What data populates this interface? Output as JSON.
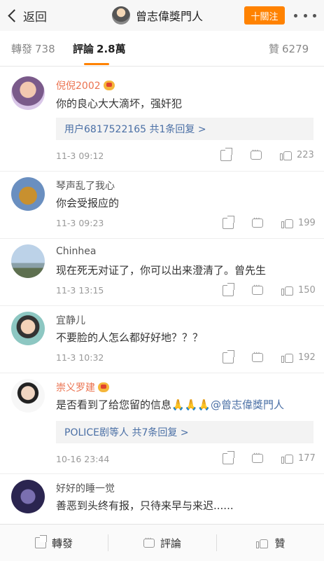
{
  "header": {
    "back_label": "返回",
    "title": "曾志偉獎門人",
    "follow_label": "十關注",
    "more_icon": "more-dots-icon"
  },
  "tabs": [
    {
      "label": "轉發",
      "count": "738"
    },
    {
      "label": "評論",
      "count": "2.8萬"
    },
    {
      "label": "贊",
      "count": "6279"
    }
  ],
  "comments": [
    {
      "user": "倪倪2002",
      "vip": true,
      "text": "你的良心大大滴坏，强奸犯",
      "reply": "用户6817522165  共1条回复 >",
      "time": "11-3 09:12",
      "likes": "223"
    },
    {
      "user": "琴声乱了我心",
      "vip": false,
      "text": "你会受报应的",
      "reply": null,
      "time": "11-3 09:23",
      "likes": "199"
    },
    {
      "user": "Chinhea",
      "vip": false,
      "text": "现在死无对证了，你可以出来澄清了。曾先生",
      "reply": null,
      "time": "11-3 13:15",
      "likes": "150"
    },
    {
      "user": "宜静儿",
      "vip": false,
      "text": "不要脸的人怎么都好好地？？？",
      "reply": null,
      "time": "11-3 10:32",
      "likes": "192"
    },
    {
      "user": "崇义罗建",
      "vip": true,
      "text": "是否看到了给您留的信息🙏🙏🙏",
      "mention": "@曾志偉獎門人",
      "reply": "POLICE剧等人  共7条回复 >",
      "time": "10-16 23:44",
      "likes": "177"
    },
    {
      "user": "好好的睡一觉",
      "vip": false,
      "text": "善恶到头终有报，只待来早与来迟......",
      "reply": null,
      "time": "",
      "likes": ""
    }
  ],
  "bottom_bar": {
    "repost_label": "轉發",
    "comment_label": "評論",
    "like_label": "贊"
  },
  "colors": {
    "accent": "#ff8200",
    "link": "#4a6fa5",
    "vip_name": "#eb7350"
  }
}
